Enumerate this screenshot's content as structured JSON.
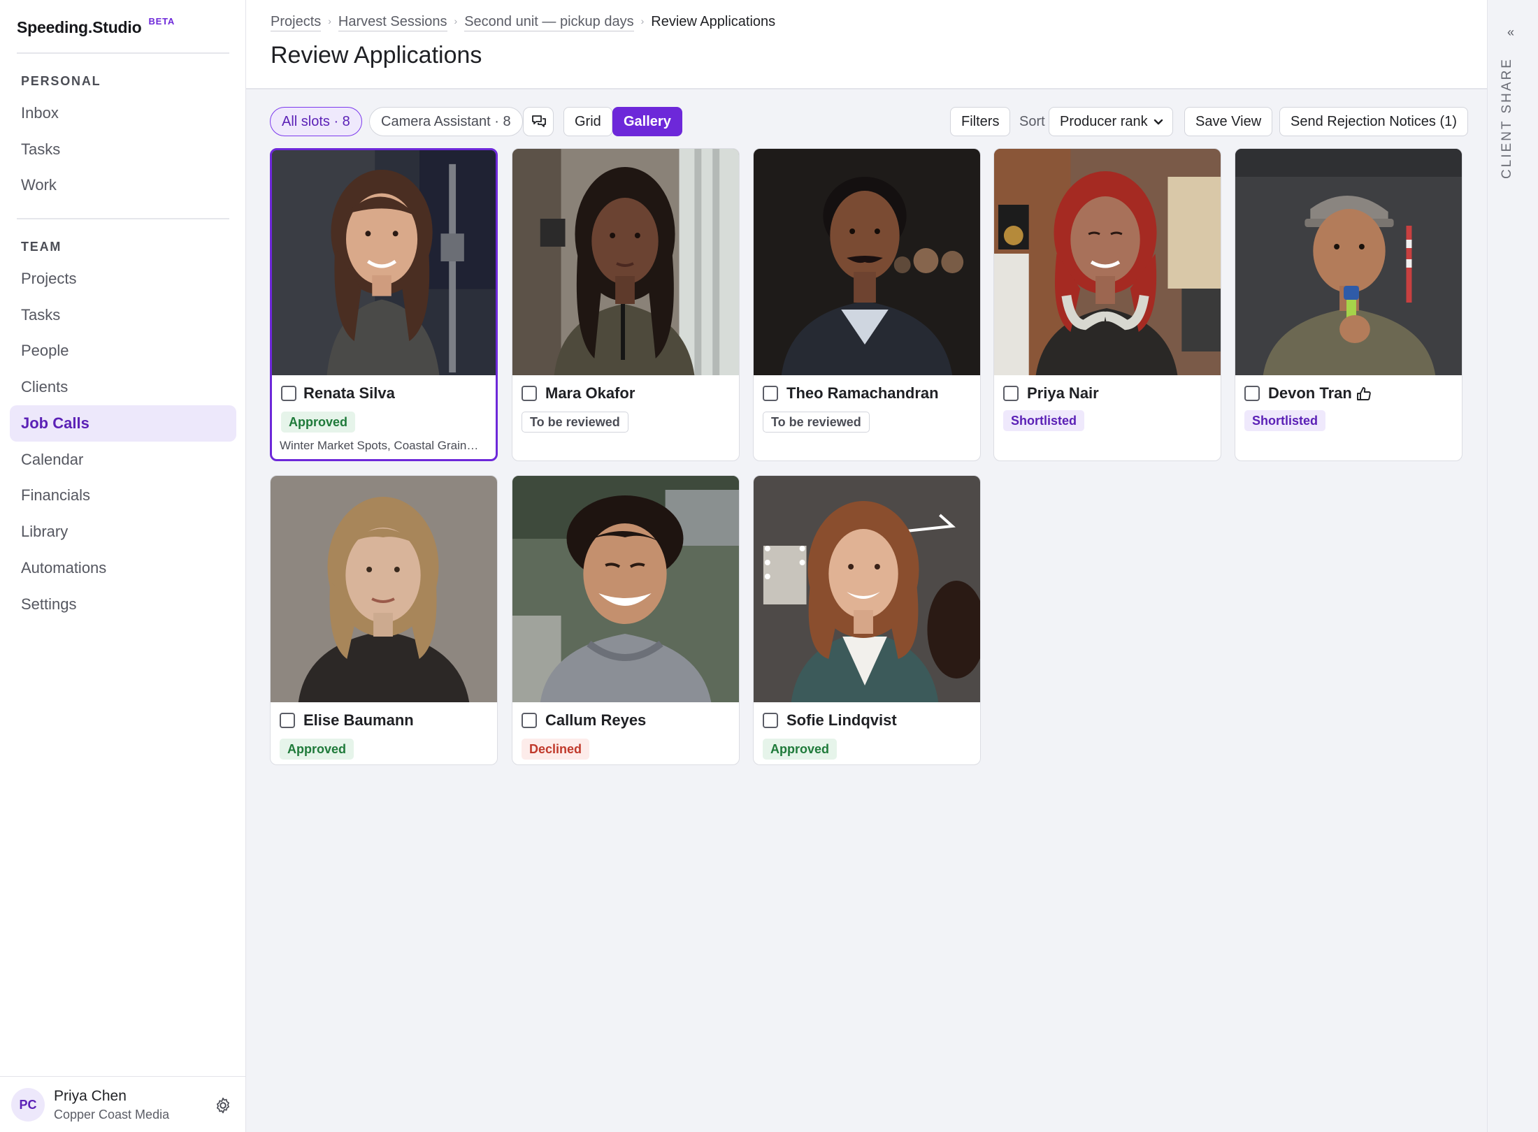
{
  "app": {
    "name": "Speeding.Studio",
    "badge": "BETA"
  },
  "sidebar": {
    "personal_heading": "PERSONAL",
    "personal": [
      {
        "label": "Inbox"
      },
      {
        "label": "Tasks"
      },
      {
        "label": "Work"
      }
    ],
    "team_heading": "TEAM",
    "team": [
      {
        "label": "Projects"
      },
      {
        "label": "Tasks"
      },
      {
        "label": "People"
      },
      {
        "label": "Clients"
      },
      {
        "label": "Job Calls",
        "active": true
      },
      {
        "label": "Calendar"
      },
      {
        "label": "Financials"
      },
      {
        "label": "Library"
      },
      {
        "label": "Automations"
      },
      {
        "label": "Settings"
      }
    ],
    "user": {
      "initials": "PC",
      "name": "Priya Chen",
      "org": "Copper Coast Media"
    }
  },
  "header": {
    "breadcrumbs": [
      "Projects",
      "Harvest Sessions",
      "Second unit — pickup days",
      "Review Applications"
    ],
    "title": "Review Applications"
  },
  "toolbar": {
    "filter_all": "All slots · 8",
    "filter_role": "Camera Assistant · 8",
    "view_grid": "Grid",
    "view_gallery": "Gallery",
    "filters": "Filters",
    "sort_label": "Sort",
    "sort_value": "Producer rank",
    "save_view": "Save View",
    "send_rejections": "Send Rejection Notices (1)"
  },
  "rail": {
    "label": "CLIENT SHARE",
    "collapse": "«"
  },
  "applicants": [
    {
      "name": "Renata Silva",
      "status": "Approved",
      "status_kind": "approved",
      "note": "Winter Market Spots, Coastal Grain…",
      "selected": true
    },
    {
      "name": "Mara Okafor",
      "status": "To be reviewed",
      "status_kind": "review"
    },
    {
      "name": "Theo Ramachandran",
      "status": "To be reviewed",
      "status_kind": "review"
    },
    {
      "name": "Priya Nair",
      "status": "Shortlisted",
      "status_kind": "shortlisted"
    },
    {
      "name": "Devon Tran",
      "status": "Shortlisted",
      "status_kind": "shortlisted",
      "thumbs_up": true
    },
    {
      "name": "Elise Baumann",
      "status": "Approved",
      "status_kind": "approved"
    },
    {
      "name": "Callum Reyes",
      "status": "Declined",
      "status_kind": "declined"
    },
    {
      "name": "Sofie Lindqvist",
      "status": "Approved",
      "status_kind": "approved"
    }
  ],
  "colors": {
    "accent": "#6d28d9",
    "approved": "#1f7a3a",
    "declined": "#c0392b",
    "shortlisted": "#5b21b6"
  }
}
